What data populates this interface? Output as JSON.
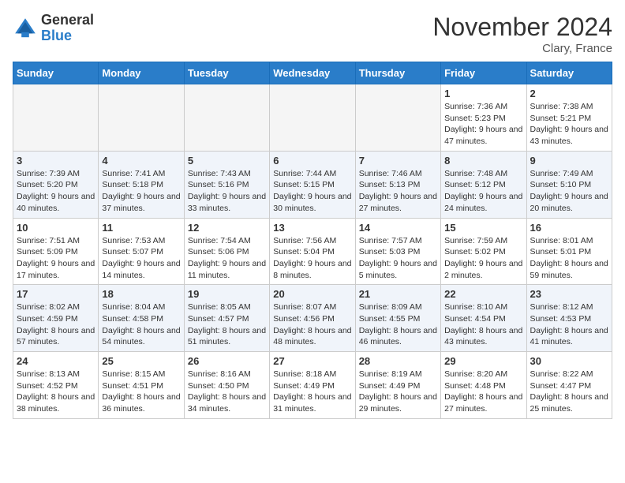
{
  "header": {
    "logo_general": "General",
    "logo_blue": "Blue",
    "month_title": "November 2024",
    "location": "Clary, France"
  },
  "weekdays": [
    "Sunday",
    "Monday",
    "Tuesday",
    "Wednesday",
    "Thursday",
    "Friday",
    "Saturday"
  ],
  "weeks": [
    [
      {
        "day": "",
        "info": ""
      },
      {
        "day": "",
        "info": ""
      },
      {
        "day": "",
        "info": ""
      },
      {
        "day": "",
        "info": ""
      },
      {
        "day": "",
        "info": ""
      },
      {
        "day": "1",
        "info": "Sunrise: 7:36 AM\nSunset: 5:23 PM\nDaylight: 9 hours and 47 minutes."
      },
      {
        "day": "2",
        "info": "Sunrise: 7:38 AM\nSunset: 5:21 PM\nDaylight: 9 hours and 43 minutes."
      }
    ],
    [
      {
        "day": "3",
        "info": "Sunrise: 7:39 AM\nSunset: 5:20 PM\nDaylight: 9 hours and 40 minutes."
      },
      {
        "day": "4",
        "info": "Sunrise: 7:41 AM\nSunset: 5:18 PM\nDaylight: 9 hours and 37 minutes."
      },
      {
        "day": "5",
        "info": "Sunrise: 7:43 AM\nSunset: 5:16 PM\nDaylight: 9 hours and 33 minutes."
      },
      {
        "day": "6",
        "info": "Sunrise: 7:44 AM\nSunset: 5:15 PM\nDaylight: 9 hours and 30 minutes."
      },
      {
        "day": "7",
        "info": "Sunrise: 7:46 AM\nSunset: 5:13 PM\nDaylight: 9 hours and 27 minutes."
      },
      {
        "day": "8",
        "info": "Sunrise: 7:48 AM\nSunset: 5:12 PM\nDaylight: 9 hours and 24 minutes."
      },
      {
        "day": "9",
        "info": "Sunrise: 7:49 AM\nSunset: 5:10 PM\nDaylight: 9 hours and 20 minutes."
      }
    ],
    [
      {
        "day": "10",
        "info": "Sunrise: 7:51 AM\nSunset: 5:09 PM\nDaylight: 9 hours and 17 minutes."
      },
      {
        "day": "11",
        "info": "Sunrise: 7:53 AM\nSunset: 5:07 PM\nDaylight: 9 hours and 14 minutes."
      },
      {
        "day": "12",
        "info": "Sunrise: 7:54 AM\nSunset: 5:06 PM\nDaylight: 9 hours and 11 minutes."
      },
      {
        "day": "13",
        "info": "Sunrise: 7:56 AM\nSunset: 5:04 PM\nDaylight: 9 hours and 8 minutes."
      },
      {
        "day": "14",
        "info": "Sunrise: 7:57 AM\nSunset: 5:03 PM\nDaylight: 9 hours and 5 minutes."
      },
      {
        "day": "15",
        "info": "Sunrise: 7:59 AM\nSunset: 5:02 PM\nDaylight: 9 hours and 2 minutes."
      },
      {
        "day": "16",
        "info": "Sunrise: 8:01 AM\nSunset: 5:01 PM\nDaylight: 8 hours and 59 minutes."
      }
    ],
    [
      {
        "day": "17",
        "info": "Sunrise: 8:02 AM\nSunset: 4:59 PM\nDaylight: 8 hours and 57 minutes."
      },
      {
        "day": "18",
        "info": "Sunrise: 8:04 AM\nSunset: 4:58 PM\nDaylight: 8 hours and 54 minutes."
      },
      {
        "day": "19",
        "info": "Sunrise: 8:05 AM\nSunset: 4:57 PM\nDaylight: 8 hours and 51 minutes."
      },
      {
        "day": "20",
        "info": "Sunrise: 8:07 AM\nSunset: 4:56 PM\nDaylight: 8 hours and 48 minutes."
      },
      {
        "day": "21",
        "info": "Sunrise: 8:09 AM\nSunset: 4:55 PM\nDaylight: 8 hours and 46 minutes."
      },
      {
        "day": "22",
        "info": "Sunrise: 8:10 AM\nSunset: 4:54 PM\nDaylight: 8 hours and 43 minutes."
      },
      {
        "day": "23",
        "info": "Sunrise: 8:12 AM\nSunset: 4:53 PM\nDaylight: 8 hours and 41 minutes."
      }
    ],
    [
      {
        "day": "24",
        "info": "Sunrise: 8:13 AM\nSunset: 4:52 PM\nDaylight: 8 hours and 38 minutes."
      },
      {
        "day": "25",
        "info": "Sunrise: 8:15 AM\nSunset: 4:51 PM\nDaylight: 8 hours and 36 minutes."
      },
      {
        "day": "26",
        "info": "Sunrise: 8:16 AM\nSunset: 4:50 PM\nDaylight: 8 hours and 34 minutes."
      },
      {
        "day": "27",
        "info": "Sunrise: 8:18 AM\nSunset: 4:49 PM\nDaylight: 8 hours and 31 minutes."
      },
      {
        "day": "28",
        "info": "Sunrise: 8:19 AM\nSunset: 4:49 PM\nDaylight: 8 hours and 29 minutes."
      },
      {
        "day": "29",
        "info": "Sunrise: 8:20 AM\nSunset: 4:48 PM\nDaylight: 8 hours and 27 minutes."
      },
      {
        "day": "30",
        "info": "Sunrise: 8:22 AM\nSunset: 4:47 PM\nDaylight: 8 hours and 25 minutes."
      }
    ]
  ]
}
